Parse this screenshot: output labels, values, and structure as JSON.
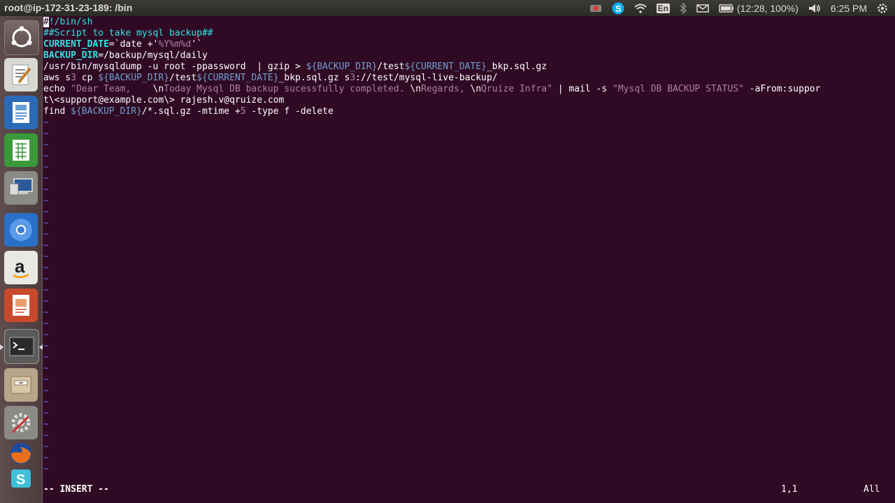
{
  "window": {
    "title": "root@ip-172-31-23-189: /bin"
  },
  "panel": {
    "lang": "En",
    "battery": "(12:28, 100%)",
    "clock": "6:25 PM"
  },
  "launcher": {
    "icons": [
      "ubuntu-dash-icon",
      "text-editor-icon",
      "writer-icon",
      "calc-icon",
      "remote-desktop-icon",
      "chromium-icon",
      "amazon-icon",
      "impress-icon",
      "terminal-icon",
      "files-icon",
      "settings-icon",
      "firefox-icon",
      "sublime-icon"
    ]
  },
  "colors": {
    "bg": "#300a24",
    "comment": "#34e2e2",
    "string": "#ad7fa8",
    "var": "#729fcf",
    "tilde": "#5c66e8"
  },
  "editor": {
    "l1_cursor": "#",
    "l1_rest": "!/bin/sh",
    "l2": "##Script to take mysql backup##",
    "l3_a": "CURRENT_DATE",
    "l3_b": "=`date +'",
    "l3_c": "%Y%m%d",
    "l3_d": "'`",
    "l4_a": "BACKUP_DIR",
    "l4_b": "=/backup/mysql/daily",
    "l5_a": "/usr/bin/mysqldump -u root -ppassword  | gzip > ",
    "l5_b": "${BACKUP_DIR}",
    "l5_c": "/test",
    "l5_d": "${CURRENT_DATE}",
    "l5_e": "_bkp.sql.gz",
    "l6_a": "aws s",
    "l6_b": "3",
    "l6_c": " cp ",
    "l6_d": "${BACKUP_DIR}",
    "l6_e": "/test",
    "l6_f": "${CURRENT_DATE}",
    "l6_g": "_bkp.sql.gz s",
    "l6_h": "3",
    "l6_i": "://test/mysql-live-backup/",
    "l7_a": "echo ",
    "l7_b": "\"Dear Team,    ",
    "l7_c": "\\n",
    "l7_d": "Today Mysql DB backup sucessfully completed. ",
    "l7_e": "\\n",
    "l7_f": "Regards, ",
    "l7_g": "\\n",
    "l7_h": "Qruize Infra\"",
    "l7_i": " | mail -s ",
    "l7_j": "\"Mysql DB BACKUP STATUS\"",
    "l7_k": " -aFrom:suppor",
    "l8": "t\\<support@example.com\\> rajesh.v@qruize.com",
    "l9_a": "find ",
    "l9_b": "${BACKUP_DIR}",
    "l9_c": "/*.sql.gz -mtime +",
    "l9_d": "5",
    "l9_e": " -type f -delete",
    "tilde": "~",
    "mode": "-- INSERT --",
    "position": "1,1",
    "scroll": "All"
  }
}
